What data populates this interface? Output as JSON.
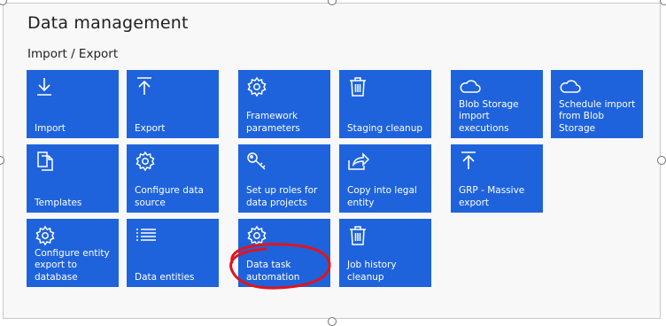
{
  "header": {
    "title": "Data management"
  },
  "section": {
    "title": "Import / Export"
  },
  "tiles": [
    {
      "label": "Import",
      "icon": "download-icon"
    },
    {
      "label": "Export",
      "icon": "upload-icon"
    },
    {
      "label": "Framework parameters",
      "icon": "gear-icon"
    },
    {
      "label": "Staging cleanup",
      "icon": "trash-icon"
    },
    {
      "label": "Blob Storage import executions",
      "icon": "cloud-icon"
    },
    {
      "label": "Schedule import from Blob Storage",
      "icon": "cloud-icon"
    },
    {
      "label": "Templates",
      "icon": "copy-icon"
    },
    {
      "label": "Configure data source",
      "icon": "gear-icon"
    },
    {
      "label": "Set up roles for data projects",
      "icon": "key-icon"
    },
    {
      "label": "Copy into legal entity",
      "icon": "share-arrow-icon"
    },
    {
      "label": "GRP - Massive export",
      "icon": "upload-icon"
    },
    {
      "label": "Configure entity export to database",
      "icon": "gear-icon"
    },
    {
      "label": "Data entities",
      "icon": "list-icon"
    },
    {
      "label": "Data task automation",
      "icon": "gear-icon"
    },
    {
      "label": "Job history cleanup",
      "icon": "trash-icon"
    }
  ],
  "colors": {
    "tile": "#1e63db",
    "annotation": "#e0141e"
  }
}
